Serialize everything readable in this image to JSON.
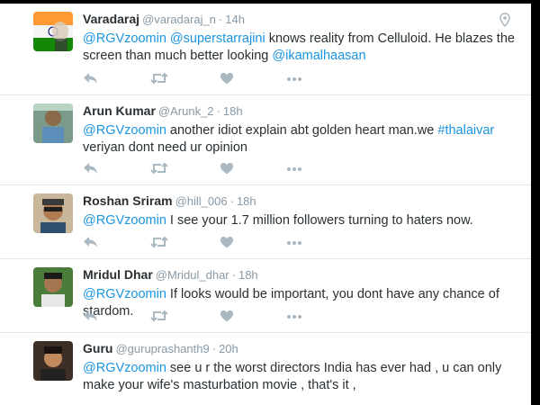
{
  "tweets": [
    {
      "name": "Varadaraj",
      "handle": "@varadaraj_n",
      "time": "14h",
      "text_parts": [
        {
          "t": "@RGVzoomin",
          "k": "mention"
        },
        {
          "t": " ",
          "k": "text"
        },
        {
          "t": "@superstarrajini",
          "k": "mention"
        },
        {
          "t": " knows reality from Celluloid. He blazes the screen than much better looking ",
          "k": "text"
        },
        {
          "t": "@ikamalhaasan",
          "k": "mention"
        }
      ]
    },
    {
      "name": "Arun Kumar",
      "handle": "@Arunk_2",
      "time": "18h",
      "text_parts": [
        {
          "t": "@RGVzoomin",
          "k": "mention"
        },
        {
          "t": " another idiot explain abt golden heart man.we ",
          "k": "text"
        },
        {
          "t": "#thalaivar",
          "k": "hashtag"
        },
        {
          "t": " veriyan dont need ur opinion",
          "k": "text"
        }
      ]
    },
    {
      "name": "Roshan Sriram",
      "handle": "@hill_006",
      "time": "18h",
      "text_parts": [
        {
          "t": "@RGVzoomin",
          "k": "mention"
        },
        {
          "t": " I see your 1.7 million followers turning to haters now.",
          "k": "text"
        }
      ]
    },
    {
      "name": "Mridul Dhar",
      "handle": "@Mridul_dhar",
      "time": "18h",
      "text_parts": [
        {
          "t": "@RGVzoomin",
          "k": "mention"
        },
        {
          "t": " If looks would be important, you dont have any chance of stardom.",
          "k": "text"
        }
      ]
    },
    {
      "name": "Guru",
      "handle": "@guruprashanth9",
      "time": "20h",
      "text_parts": [
        {
          "t": "@RGVzoomin",
          "k": "mention"
        },
        {
          "t": " see u r the worst directors India has ever had , u can only make your wife's masturbation movie , that's it ,",
          "k": "text"
        }
      ]
    }
  ],
  "separator": "·",
  "icons": {
    "reply": "reply-icon",
    "retweet": "retweet-icon",
    "like": "heart-icon",
    "more": "more-icon",
    "location": "location-pin-icon"
  },
  "colors": {
    "link": "#1b95e0",
    "name": "#292f33",
    "meta": "#8899a6",
    "action_icon": "#aab8c2",
    "border": "#e1e8ed"
  }
}
